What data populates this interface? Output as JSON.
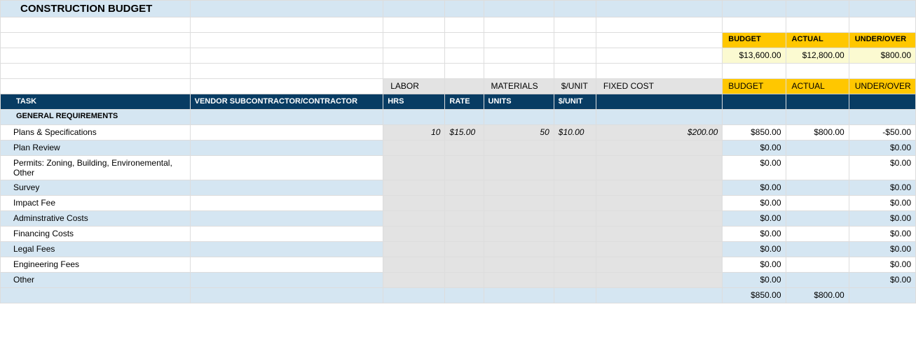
{
  "title": "CONSTRUCTION BUDGET",
  "summary_headers": {
    "budget": "BUDGET",
    "actual": "ACTUAL",
    "diff": "UNDER/OVER"
  },
  "summary_totals": {
    "budget": "$13,600.00",
    "actual": "$12,800.00",
    "diff": "$800.00"
  },
  "group_headers": {
    "labor": "LABOR",
    "materials": "MATERIALS",
    "per_unit": "$/UNIT",
    "fixedcost": "FIXED COST",
    "budget": "BUDGET",
    "actual": "ACTUAL",
    "diff": "UNDER/OVER"
  },
  "col_headers": {
    "task": "TASK",
    "vendor": "VENDOR SUBCONTRACTOR/CONTRACTOR",
    "hrs": "HRS",
    "rate": "RATE",
    "units": "UNITS",
    "per_unit": "$/UNIT"
  },
  "section_title": "GENERAL REQUIREMENTS",
  "rows": [
    {
      "task": "Plans & Specifications",
      "hrs": "10",
      "rate": "$15.00",
      "units": "50",
      "per_unit": "$10.00",
      "fixed": "$200.00",
      "budget": "$850.00",
      "actual": "$800.00",
      "diff": "-$50.00"
    },
    {
      "task": "Plan Review",
      "hrs": "",
      "rate": "",
      "units": "",
      "per_unit": "",
      "fixed": "",
      "budget": "$0.00",
      "actual": "",
      "diff": "$0.00"
    },
    {
      "task": "Permits: Zoning, Building, Environemental, Other",
      "hrs": "",
      "rate": "",
      "units": "",
      "per_unit": "",
      "fixed": "",
      "budget": "$0.00",
      "actual": "",
      "diff": "$0.00"
    },
    {
      "task": "Survey",
      "hrs": "",
      "rate": "",
      "units": "",
      "per_unit": "",
      "fixed": "",
      "budget": "$0.00",
      "actual": "",
      "diff": "$0.00"
    },
    {
      "task": "Impact Fee",
      "hrs": "",
      "rate": "",
      "units": "",
      "per_unit": "",
      "fixed": "",
      "budget": "$0.00",
      "actual": "",
      "diff": "$0.00"
    },
    {
      "task": "Adminstrative Costs",
      "hrs": "",
      "rate": "",
      "units": "",
      "per_unit": "",
      "fixed": "",
      "budget": "$0.00",
      "actual": "",
      "diff": "$0.00"
    },
    {
      "task": "Financing Costs",
      "hrs": "",
      "rate": "",
      "units": "",
      "per_unit": "",
      "fixed": "",
      "budget": "$0.00",
      "actual": "",
      "diff": "$0.00"
    },
    {
      "task": "Legal Fees",
      "hrs": "",
      "rate": "",
      "units": "",
      "per_unit": "",
      "fixed": "",
      "budget": "$0.00",
      "actual": "",
      "diff": "$0.00"
    },
    {
      "task": "Engineering Fees",
      "hrs": "",
      "rate": "",
      "units": "",
      "per_unit": "",
      "fixed": "",
      "budget": "$0.00",
      "actual": "",
      "diff": "$0.00"
    },
    {
      "task": "Other",
      "hrs": "",
      "rate": "",
      "units": "",
      "per_unit": "",
      "fixed": "",
      "budget": "$0.00",
      "actual": "",
      "diff": "$0.00"
    }
  ],
  "subtotal": {
    "budget": "$850.00",
    "actual": "$800.00",
    "diff": ""
  }
}
